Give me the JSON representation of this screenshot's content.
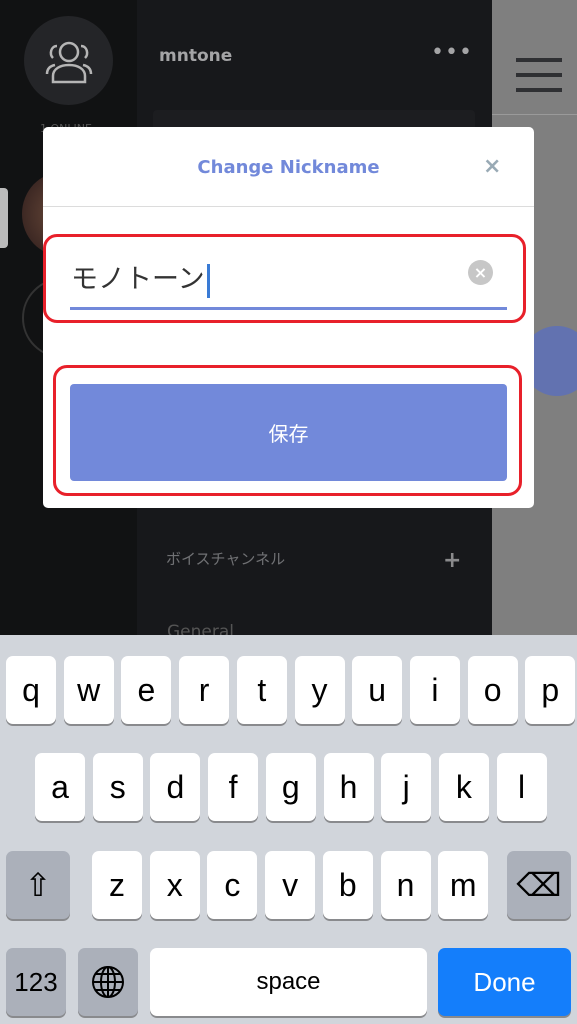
{
  "guilds": {
    "online": "1 ONLINE"
  },
  "channels": {
    "server_name": "mntone",
    "more": "•••",
    "voice_header": "ボイスチャンネル",
    "add": "+",
    "general": "General"
  },
  "modal": {
    "title": "Change Nickname",
    "close": "×",
    "nickname_value": "モノトーン",
    "clear": "×",
    "save_label": "保存"
  },
  "keyboard": {
    "row1": [
      "q",
      "w",
      "e",
      "r",
      "t",
      "y",
      "u",
      "i",
      "o",
      "p"
    ],
    "row2": [
      "a",
      "s",
      "d",
      "f",
      "g",
      "h",
      "j",
      "k",
      "l"
    ],
    "row3": [
      "z",
      "x",
      "c",
      "v",
      "b",
      "n",
      "m"
    ],
    "numbers": "123",
    "space": "space",
    "done": "Done",
    "shift": "⇧",
    "backspace": "⌫",
    "globe": "globe-icon"
  },
  "colors": {
    "accent": "#7289da",
    "highlight": "#e8202a",
    "done": "#147efb"
  }
}
